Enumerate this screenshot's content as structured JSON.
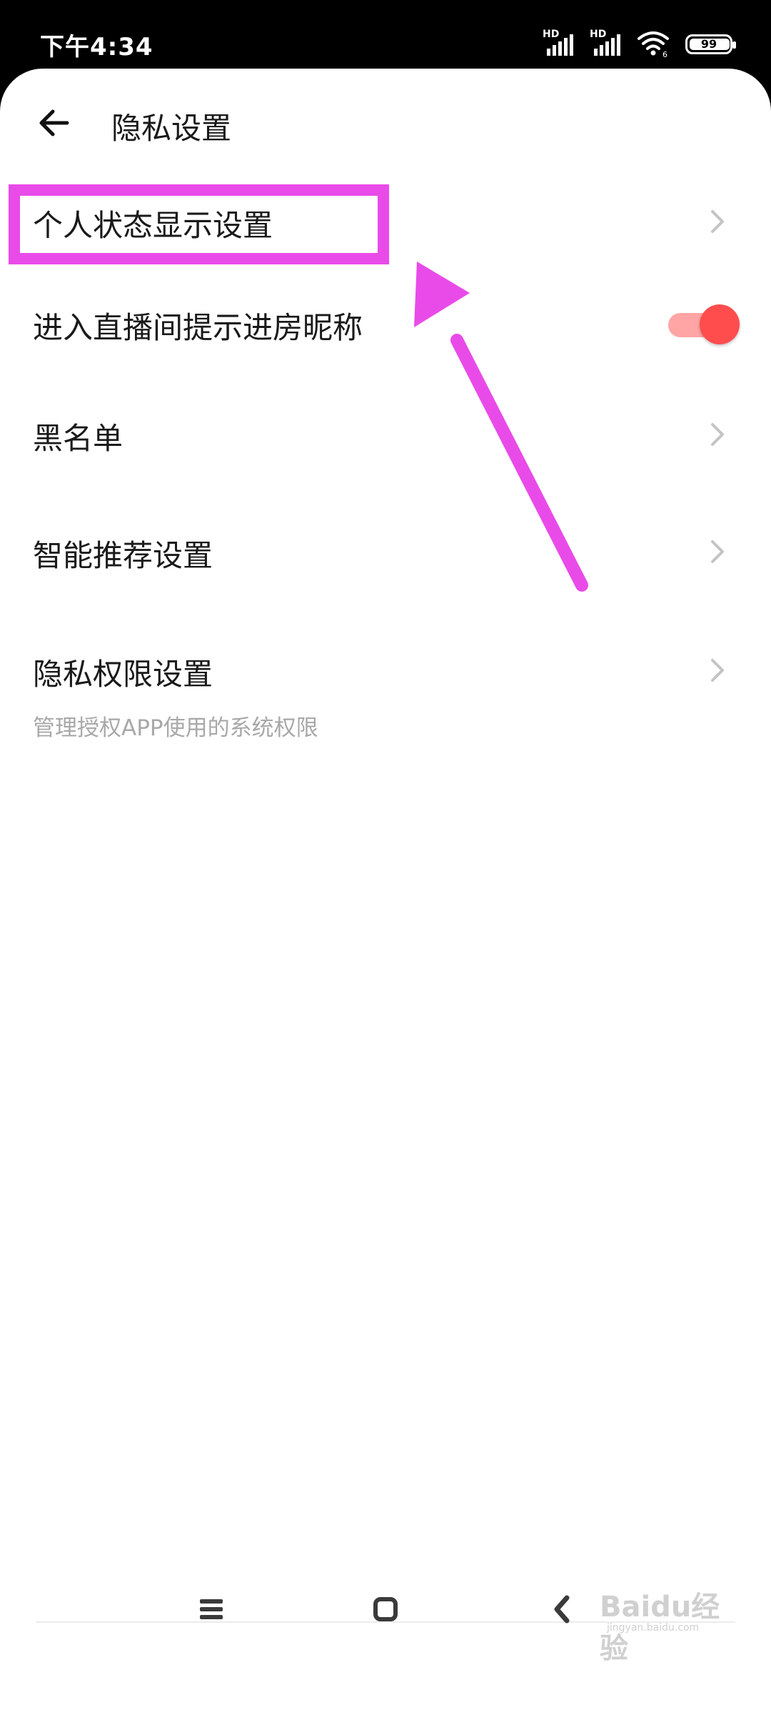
{
  "status_bar": {
    "time": "下午4:34",
    "signal_1_label": "HD",
    "signal_2_label": "HD",
    "wifi_label": "6",
    "battery": "99"
  },
  "header": {
    "title": "隐私设置",
    "back_icon": "arrow-left-icon"
  },
  "settings": {
    "items": [
      {
        "label": "个人状态显示设置",
        "control": "chevron"
      },
      {
        "label": "进入直播间提示进房昵称",
        "control": "toggle",
        "toggle_on": true
      },
      {
        "label": "黑名单",
        "control": "chevron"
      },
      {
        "label": "智能推荐设置",
        "control": "chevron"
      },
      {
        "label": "隐私权限设置",
        "subtitle": "管理授权APP使用的系统权限",
        "control": "chevron"
      }
    ]
  },
  "colors": {
    "accent": "#ff4d4d",
    "toggle_track": "#ffa5a5",
    "annotation": "#e94be9",
    "subtitle": "#a8a8a8"
  },
  "nav_bar": {
    "menu_icon": "menu-icon",
    "home_icon": "home-square-icon",
    "back_icon": "chevron-left-icon"
  },
  "watermark": {
    "brand": "Baidu经验",
    "domain": "jingyan.baidu.com"
  }
}
